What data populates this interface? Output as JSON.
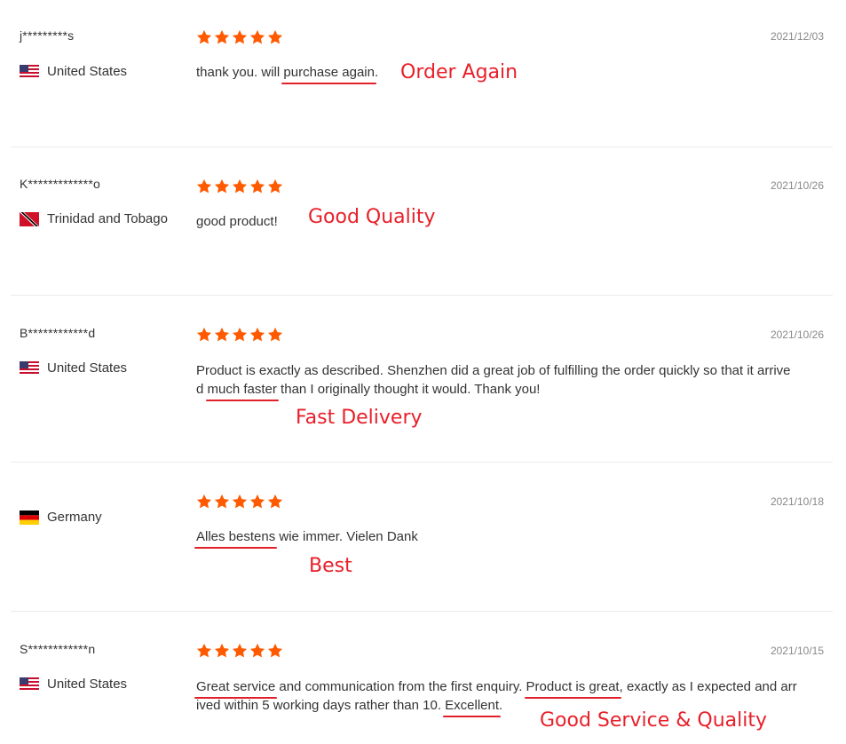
{
  "colors": {
    "star": "#ff5a00",
    "annotation": "#e8202a",
    "date": "#888888"
  },
  "reviews": [
    {
      "user": "j*********s",
      "country": "United States",
      "flag": "us-flag-icon",
      "rating": 5,
      "date": "2021/12/03",
      "text_parts": [
        "thank you. will ",
        "purchase again",
        "."
      ],
      "tag": "Order Again"
    },
    {
      "user": "K*************o",
      "country": "Trinidad and Tobago",
      "flag": "tt-flag-icon",
      "rating": 5,
      "date": "2021/10/26",
      "text_parts": [
        "good product!"
      ],
      "tag": "Good Quality"
    },
    {
      "user": "B************d",
      "country": "United States",
      "flag": "us-flag-icon",
      "rating": 5,
      "date": "2021/10/26",
      "text_parts": [
        "Product is exactly as described. Shenzhen did a great job of fulfilling the order quickly so that it arrive",
        "d ",
        "much faster",
        " than I originally thought it would. Thank you!"
      ],
      "tag": "Fast Delivery"
    },
    {
      "user": "",
      "country": "Germany",
      "flag": "de-flag-icon",
      "rating": 5,
      "date": "2021/10/18",
      "text_parts": [
        "Alles bestens",
        " wie immer. Vielen Dank"
      ],
      "tag": "Best"
    },
    {
      "user": "S************n",
      "country": "United States",
      "flag": "us-flag-icon",
      "rating": 5,
      "date": "2021/10/15",
      "text_parts": [
        "Great service",
        " and communication from the first enquiry. ",
        "Product is great",
        ", exactly as I expected and arr",
        "ived within 5 working days rather than 10. ",
        "Excellent",
        "."
      ],
      "tag": "Good Service & Quality"
    }
  ]
}
